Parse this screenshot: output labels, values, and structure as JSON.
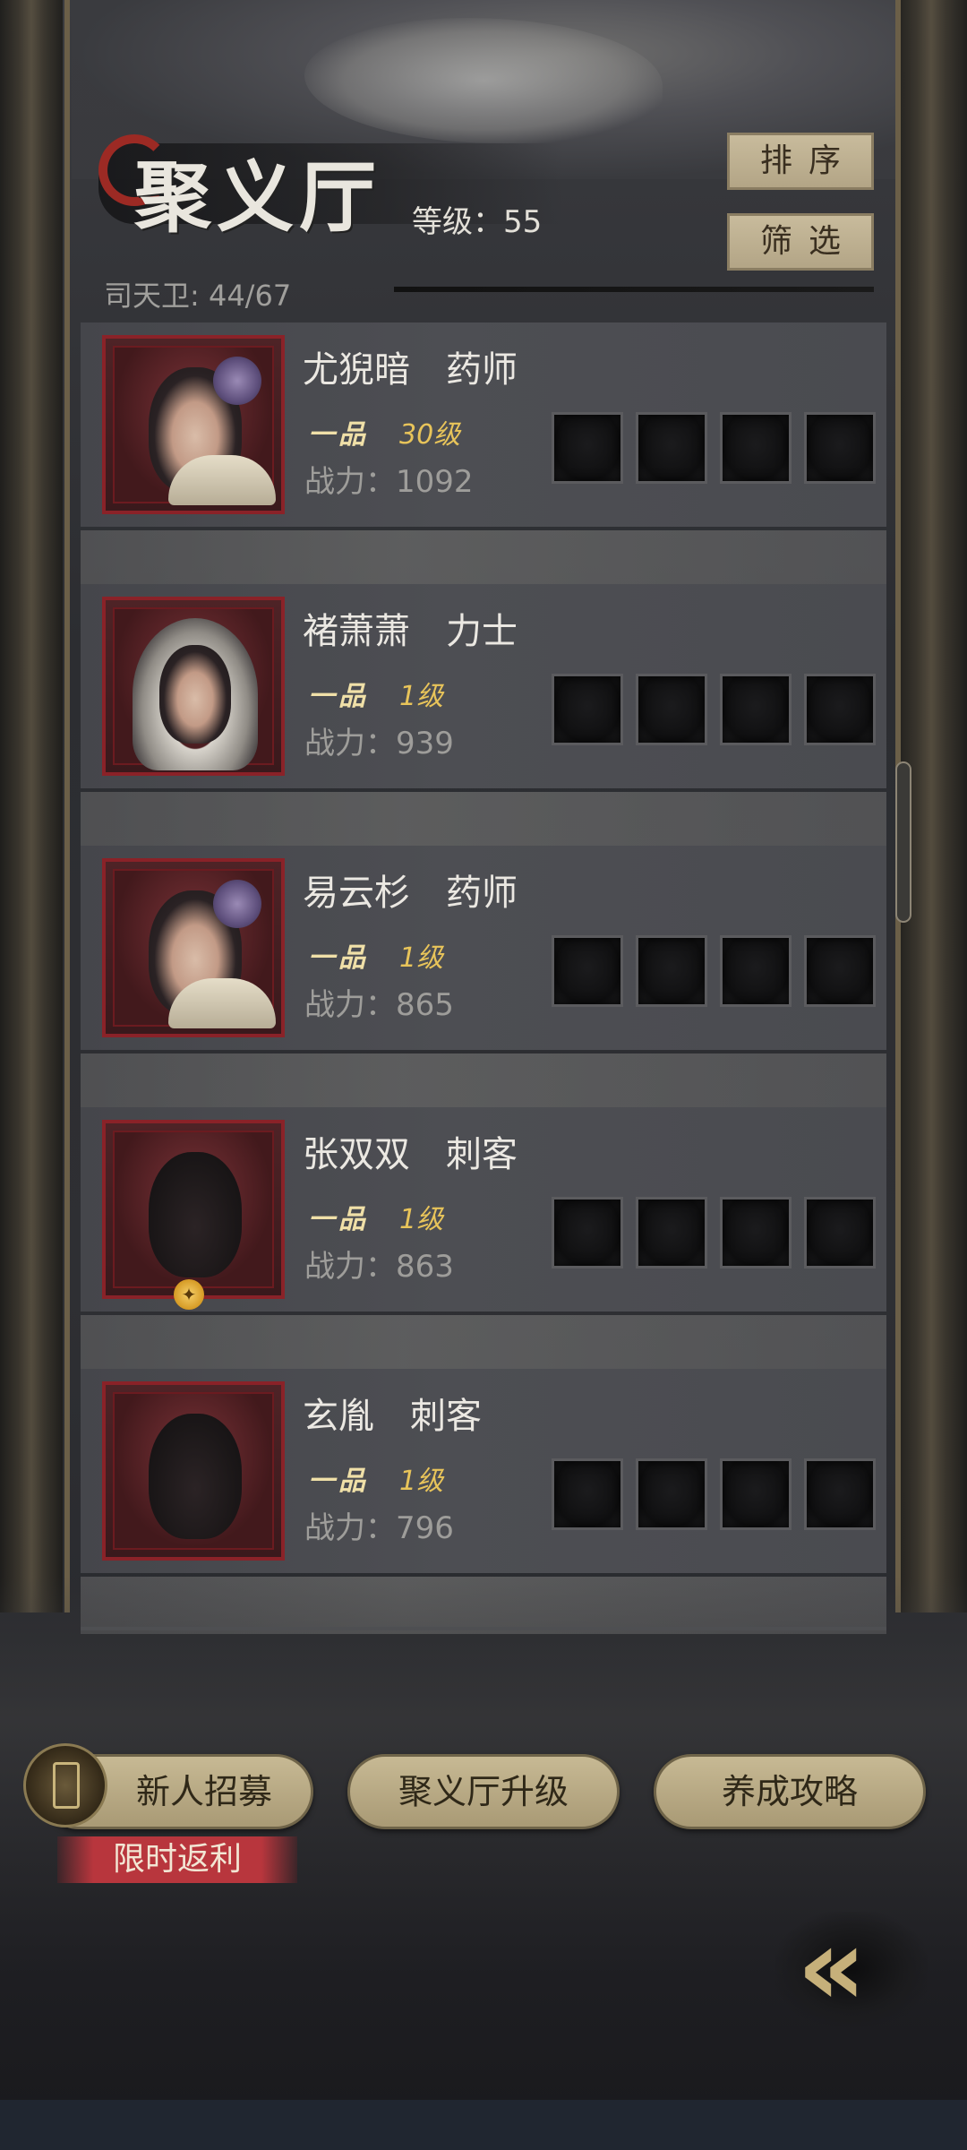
{
  "header": {
    "title": "聚义厅",
    "level_label": "等级：55",
    "guard_count": "司天卫: 44/67",
    "sort_label": "排序",
    "filter_label": "筛选"
  },
  "heroes": [
    {
      "name": "尤猊暗　药师",
      "rank": "一品",
      "level": "30级",
      "power": "战力：1092"
    },
    {
      "name": "褚萧萧　力士",
      "rank": "一品",
      "level": "1级",
      "power": "战力：939"
    },
    {
      "name": "易云杉　药师",
      "rank": "一品",
      "level": "1级",
      "power": "战力：865"
    },
    {
      "name": "张双双　刺客",
      "rank": "一品",
      "level": "1级",
      "power": "战力：863"
    },
    {
      "name": "玄胤　刺客",
      "rank": "一品",
      "level": "1级",
      "power": "战力：796"
    }
  ],
  "footer": {
    "recruit_label": "新人招募",
    "upgrade_label": "聚义厅升级",
    "guide_label": "养成攻略",
    "promo_label": "限时返利",
    "back_glyph": "«"
  },
  "colors": {
    "frame_red": "#8a2228",
    "button_tan": "#c7b994",
    "level_gold": "#e8c45a",
    "promo_red": "#b8363d"
  }
}
